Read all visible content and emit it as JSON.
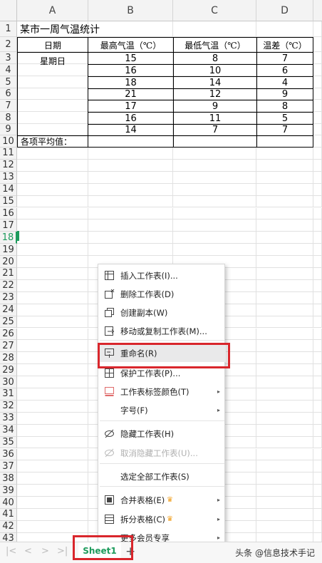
{
  "columns": [
    "A",
    "B",
    "C",
    "D"
  ],
  "rows": [
    "1",
    "2",
    "3",
    "4",
    "5",
    "6",
    "7",
    "8",
    "9",
    "10",
    "11",
    "12",
    "13",
    "14",
    "15",
    "16",
    "17",
    "18",
    "19",
    "20",
    "21",
    "22",
    "23",
    "24",
    "25",
    "26",
    "27",
    "28",
    "29",
    "30",
    "31",
    "32",
    "33",
    "34",
    "35",
    "36",
    "37",
    "38",
    "39",
    "40",
    "41",
    "42",
    "43"
  ],
  "sheet": {
    "title": "某市一周气温统计",
    "headers": [
      "日期",
      "最高气温（℃）",
      "最低气温（℃）",
      "温差（℃）"
    ],
    "weekday": "星期日",
    "data": [
      [
        "15",
        "8",
        "7"
      ],
      [
        "16",
        "10",
        "6"
      ],
      [
        "18",
        "14",
        "4"
      ],
      [
        "21",
        "12",
        "9"
      ],
      [
        "17",
        "9",
        "8"
      ],
      [
        "16",
        "11",
        "5"
      ],
      [
        "14",
        "7",
        "7"
      ]
    ],
    "avg_label": "各项平均值："
  },
  "context_menu": {
    "items": [
      {
        "label": "插入工作表(I)...",
        "icon": "insert-sheet-icon"
      },
      {
        "label": "删除工作表(D)",
        "icon": "delete-sheet-icon"
      },
      {
        "label": "创建副本(W)",
        "icon": "copy-sheet-icon"
      },
      {
        "label": "移动或复制工作表(M)...",
        "icon": "move-copy-icon"
      },
      {
        "label": "重命名(R)",
        "icon": "rename-icon"
      },
      {
        "label": "保护工作表(P)...",
        "icon": "protect-sheet-icon"
      },
      {
        "label": "工作表标签颜色(T)",
        "icon": "tab-color-icon"
      },
      {
        "label": "字号(F)",
        "icon": ""
      },
      {
        "label": "隐藏工作表(H)",
        "icon": "hide-sheet-icon"
      },
      {
        "label": "取消隐藏工作表(U)...",
        "icon": "unhide-sheet-icon"
      },
      {
        "label": "选定全部工作表(S)",
        "icon": ""
      },
      {
        "label": "合并表格(E)",
        "icon": "merge-tables-icon"
      },
      {
        "label": "拆分表格(C)",
        "icon": "split-table-icon"
      },
      {
        "label": "更多会员专享",
        "icon": ""
      }
    ]
  },
  "tab_bar": {
    "nav_glyphs": [
      "|<",
      "<",
      ">",
      ">|"
    ],
    "sheet_tab": "Sheet1",
    "add_glyph": "+",
    "watermark": "头条 @信息技术手记"
  },
  "colors": {
    "accent": "#1d9b5c",
    "highlight_box": "#d9262c",
    "crown": "#f0a020"
  }
}
